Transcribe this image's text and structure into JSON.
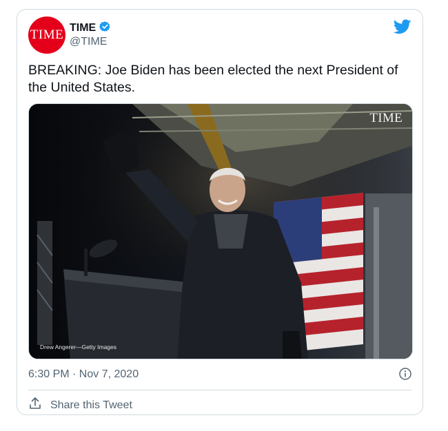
{
  "account": {
    "avatar_text": "TIME",
    "display_name": "TIME",
    "handle": "@TIME",
    "verified": true,
    "avatar_color": "#e4001b"
  },
  "tweet": {
    "text": "BREAKING: Joe Biden has been elected the next President of the United States.",
    "timestamp": "6:30 PM · Nov 7, 2020"
  },
  "media": {
    "watermark": "TIME",
    "photo_credit": "Drew Angerer—Getty Images"
  },
  "actions": {
    "share_label": "Share this Tweet"
  },
  "icons": {
    "brand": "twitter-bird-icon",
    "verified": "verified-badge-icon",
    "info": "info-icon",
    "share": "share-icon"
  },
  "colors": {
    "twitter_blue": "#1d9bf0",
    "text_primary": "#0f1419",
    "text_secondary": "#536471",
    "border": "#cfd9de"
  }
}
